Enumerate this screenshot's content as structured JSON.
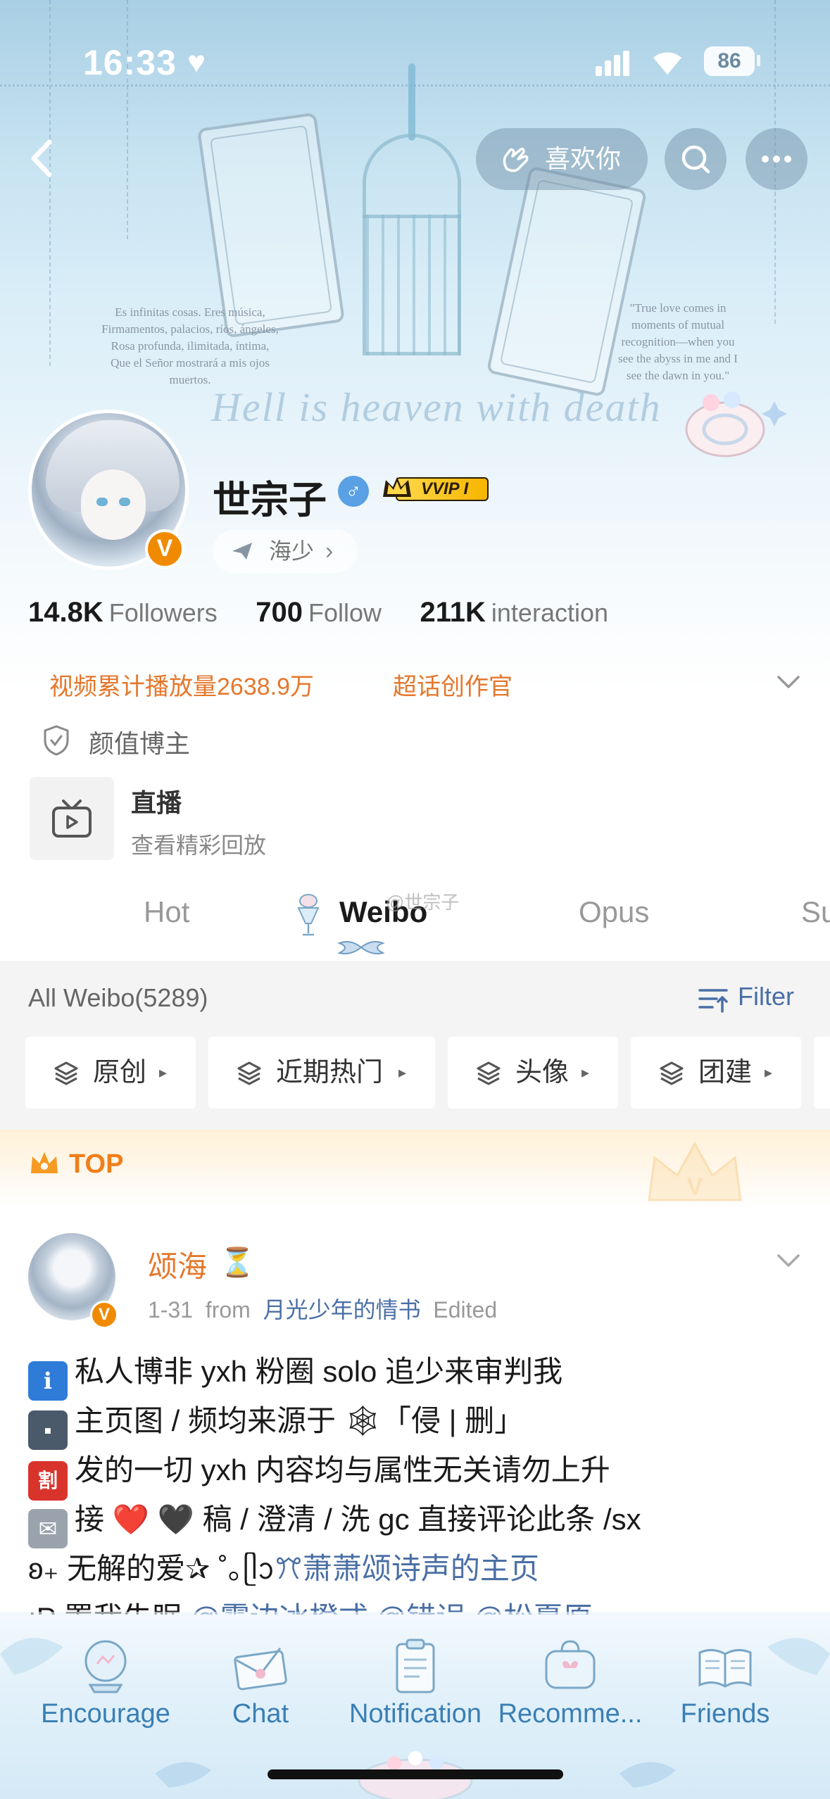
{
  "status_bar": {
    "time": "16:33",
    "battery": "86"
  },
  "header": {
    "like_label": "喜欢你",
    "poem_left": [
      "Es infinitas cosas. Eres música,",
      "Firmamentos, palacios, ríos, ángeles,",
      "Rosa profunda, ilimitada, íntima,",
      "Que el Señor mostrará a mis ojos",
      "muertos."
    ],
    "poem_right": [
      "\"True love comes in",
      "moments of mutual",
      "recognition—when you",
      "see the abyss in me and I",
      "see the dawn in you.\""
    ],
    "script_text": "Hell is heaven with death"
  },
  "profile": {
    "name": "世宗子",
    "gender_symbol": "♂",
    "vvip_label": "VVIP I",
    "location": "海少",
    "v_badge": "V",
    "stats": [
      {
        "value": "14.8K",
        "label": "Followers"
      },
      {
        "value": "700",
        "label": "Follow"
      },
      {
        "value": "211K",
        "label": "interaction"
      }
    ],
    "tags": [
      "视频累计播放量2638.9万",
      "超话创作官"
    ],
    "verified_tag": "颜值博主",
    "live": {
      "title": "直播",
      "subtitle": "查看精彩回放"
    }
  },
  "tabs": [
    {
      "label": "Hot",
      "active": false
    },
    {
      "label": "Weibo",
      "active": true
    },
    {
      "label": "Opus",
      "active": false
    },
    {
      "label": "Su",
      "active": false
    }
  ],
  "watermark": "@世宗子",
  "feed": {
    "all_label": "All Weibo(5289)",
    "filter_label": "Filter",
    "chips": [
      "原创",
      "近期热门",
      "头像",
      "团建"
    ],
    "top_label": "TOP"
  },
  "post": {
    "author": "颂海",
    "hourglass": "⏳",
    "date": "1-31",
    "from_label": "from",
    "source": "月光少年的情书",
    "edited": "Edited",
    "lines": [
      {
        "icon": "ℹ",
        "icon_color": "#2f7bd8",
        "text": "私人博非 yxh  粉圈 solo 追少来审判我"
      },
      {
        "icon": "▪",
        "icon_color": "#4a5a6a",
        "text": "主页图 / 频均来源于 🕸「侵 | 删」"
      },
      {
        "icon": "割",
        "icon_color": "#d8342c",
        "text": "发的一切 yxh 内容均与属性无关请勿上升"
      },
      {
        "icon": "✉",
        "icon_color": "#9aa3ad",
        "text": "接 ❤️ 🖤 稿 / 澄清 / 洗 gc   直接评论此条 /sx"
      }
    ],
    "line5_prefix": "ʚ₊ 无解的爱✰ ˚｡ᥫᩣ",
    "line5_link": "萧萧颂诗声的主页",
    "line6_prefix": "ıP 置我失眠",
    "line6_links": [
      "@雾边冰橙式",
      "@错误",
      "@松夏原"
    ]
  },
  "tabbar": [
    {
      "label": "Encourage",
      "icon": "crystal-ball-icon"
    },
    {
      "label": "Chat",
      "icon": "envelope-icon"
    },
    {
      "label": "Notification",
      "icon": "clipboard-icon"
    },
    {
      "label": "Recomme...",
      "icon": "bag-icon"
    },
    {
      "label": "Friends",
      "icon": "book-icon"
    }
  ]
}
